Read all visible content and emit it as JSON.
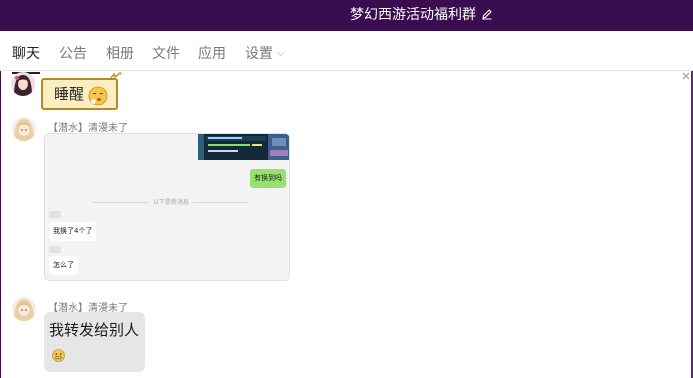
{
  "window": {
    "title": "梦幻西游活动福利群"
  },
  "tabs": [
    {
      "label": "聊天"
    },
    {
      "label": "公告"
    },
    {
      "label": "相册"
    },
    {
      "label": "文件"
    },
    {
      "label": "应用"
    },
    {
      "label": "设置"
    }
  ],
  "messages": [
    {
      "type": "sticker",
      "text": "睡醒",
      "icon": "sleepy-face-icon"
    },
    {
      "type": "forwarded-chat",
      "sender": "【潜水】清漫未了",
      "card": {
        "green_message": "有换到吗",
        "divider": "以下是新消息",
        "replies": [
          "我换了4个了",
          "怎么了"
        ]
      }
    },
    {
      "type": "text",
      "sender": "【潜水】清漫未了",
      "text": "我转发给别人",
      "icon": "grimace-emoji-icon"
    }
  ],
  "colors": {
    "titlebar": "#3a0d51",
    "sticker_bg": "#fbeec1",
    "bubble_bg": "#e6e6e6",
    "green_bubble": "#96e26f"
  }
}
